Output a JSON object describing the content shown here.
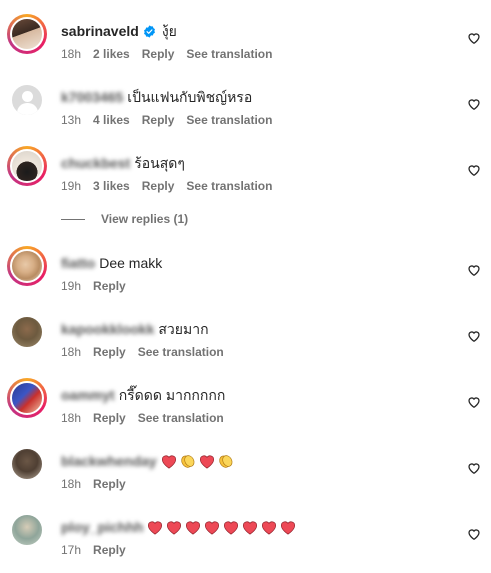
{
  "comments": [
    {
      "username": "sabrinaveld",
      "verified": true,
      "text": "งุ้ย",
      "time": "18h",
      "likes": "2 likes",
      "reply": "Reply",
      "translate": "See translation"
    },
    {
      "username": "k7003465",
      "text": "เป็นแฟนกับพิชญ์หรอ",
      "time": "13h",
      "likes": "4 likes",
      "reply": "Reply",
      "translate": "See translation"
    },
    {
      "username": "chuckbest",
      "text": "ร้อนสุดๆ",
      "time": "19h",
      "likes": "3 likes",
      "reply": "Reply",
      "translate": "See translation"
    },
    {
      "username": "fiatto",
      "text": "Dee makk",
      "time": "19h",
      "reply": "Reply"
    },
    {
      "username": "kapookklookk",
      "text": "สวยมาก",
      "time": "18h",
      "reply": "Reply",
      "translate": "See translation"
    },
    {
      "username": "oammyt",
      "text": "กรี๊ดดด มากกกกก",
      "time": "18h",
      "reply": "Reply",
      "translate": "See translation"
    },
    {
      "username": "blackwhenday",
      "emoji": [
        "heart",
        "clap",
        "heart",
        "clap"
      ],
      "time": "18h",
      "reply": "Reply"
    },
    {
      "username": "ploy_pichhh",
      "emoji": [
        "heart",
        "heart",
        "heart",
        "heart",
        "heart",
        "heart",
        "heart",
        "heart"
      ],
      "time": "17h",
      "reply": "Reply"
    }
  ],
  "view_replies": "View replies (1)",
  "colors": {
    "meta_text": "#737373",
    "verified_blue": "#0095f6",
    "heart_red": "#ed4956"
  },
  "icons": {
    "like": "heart-outline-icon",
    "verified": "verified-badge-icon"
  }
}
